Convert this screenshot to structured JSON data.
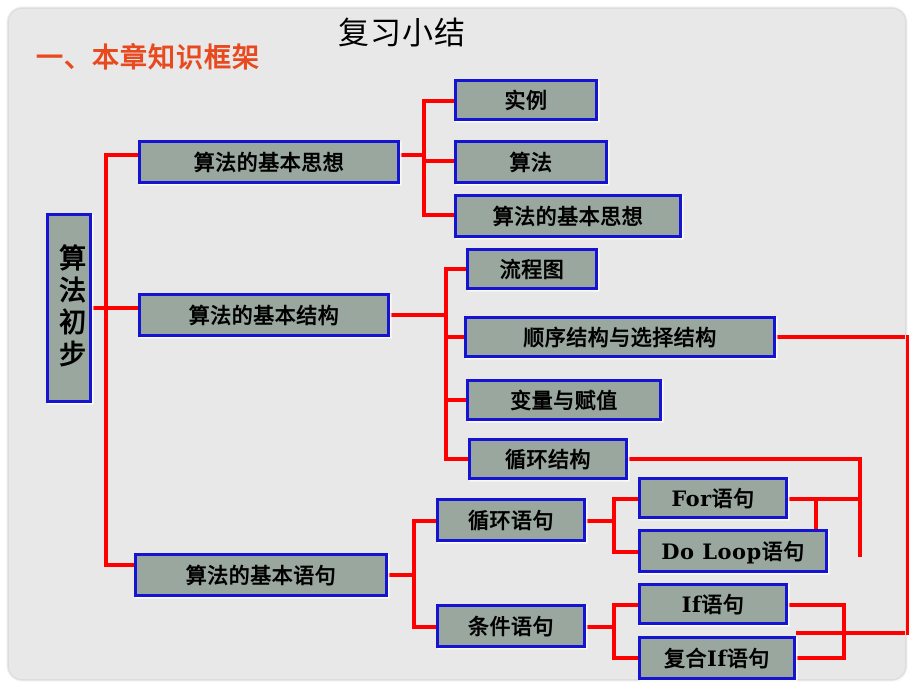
{
  "slide": {
    "title_main": "复习小结",
    "title_sub": "一、本章知识框架",
    "accent_color": "#E8491E",
    "connector_color": "#FF0000",
    "node_fill": "#9AA79F",
    "node_border": "#1414D2",
    "background": "#E8E8E8"
  },
  "diagram": {
    "root": {
      "label": "算法初步"
    },
    "branches": [
      {
        "label": "算法的基本思想",
        "children": [
          {
            "label": "实例"
          },
          {
            "label": "算法"
          },
          {
            "label": "算法的基本思想"
          }
        ]
      },
      {
        "label": "算法的基本结构",
        "children": [
          {
            "label": "流程图"
          },
          {
            "label": "顺序结构与选择结构"
          },
          {
            "label": "变量与赋值"
          },
          {
            "label": "循环结构"
          }
        ]
      },
      {
        "label": "算法的基本语句",
        "children": [
          {
            "label": "循环语句",
            "children": [
              {
                "label": "For语句"
              },
              {
                "label": "Do Loop语句"
              }
            ]
          },
          {
            "label": "条件语句",
            "children": [
              {
                "label": "If语句"
              },
              {
                "label": "复合If语句"
              }
            ]
          }
        ]
      }
    ]
  }
}
